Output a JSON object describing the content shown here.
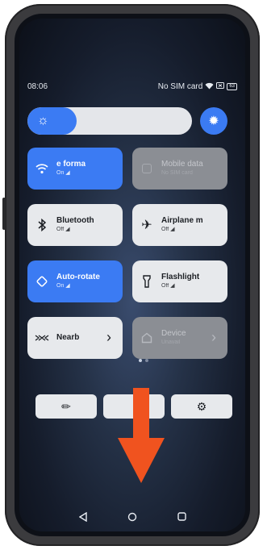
{
  "status_bar": {
    "time": "08:06",
    "sim_text": "No SIM card",
    "icons": [
      "wifi-icon",
      "sim-icon",
      "battery-icon"
    ],
    "battery": "63"
  },
  "brightness": {
    "level_fraction": 0.3,
    "icon": "sun-icon",
    "auto_icon": "auto-brightness-icon"
  },
  "tiles": [
    {
      "label": "e   forma",
      "sub": "On",
      "icon": "wifi-icon",
      "state": "active"
    },
    {
      "label": "Mobile data",
      "sub": "No SIM card",
      "icon": "mobile-data-icon",
      "state": "disabled"
    },
    {
      "label": "Bluetooth",
      "sub": "Off",
      "icon": "bluetooth-icon",
      "state": "inactive"
    },
    {
      "label": "Airplane m",
      "sub": "Off",
      "icon": "airplane-icon",
      "state": "inactive"
    },
    {
      "label": "Auto-rotate",
      "sub": "On",
      "icon": "auto-rotate-icon",
      "state": "active"
    },
    {
      "label": "Flashlight",
      "sub": "Off",
      "icon": "flashlight-icon",
      "state": "inactive"
    },
    {
      "label": "Nearb",
      "sub": "",
      "icon": "nearby-share-icon",
      "state": "inactive"
    },
    {
      "label": "Device",
      "sub": "Unavail",
      "icon": "device-controls-icon",
      "state": "disabled"
    }
  ],
  "bottom_buttons": [
    {
      "icon": "pencil-icon",
      "glyph": "✏"
    },
    {
      "icon": "power-icon",
      "glyph": ""
    },
    {
      "icon": "gear-icon",
      "glyph": "⚙"
    }
  ],
  "annotation": {
    "icon": "arrow-down-icon",
    "color": "#f0531f"
  },
  "nav": [
    "back-icon",
    "home-icon",
    "recents-icon"
  ],
  "colors": {
    "accent": "#3b7bf3",
    "tile_light": "#e7e9ec",
    "tile_disabled": "#8b8e94"
  }
}
